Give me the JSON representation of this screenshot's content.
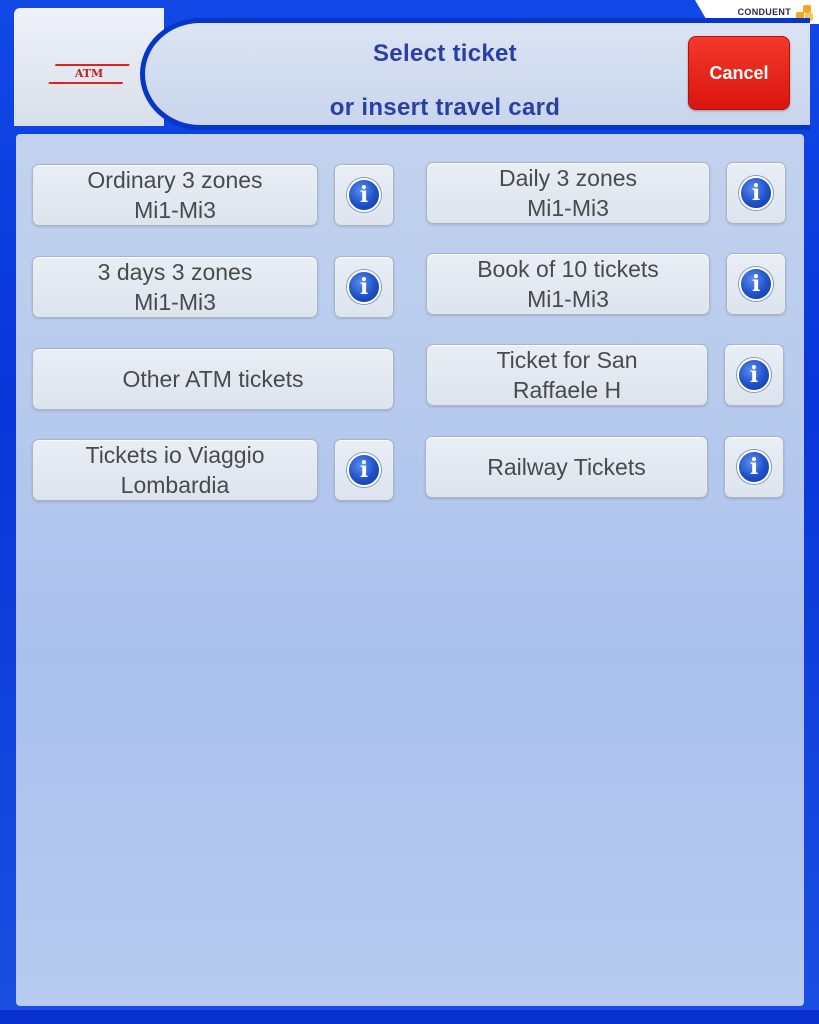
{
  "brand": {
    "vendor": "CONDUENT",
    "operator_logo": "ATM"
  },
  "header": {
    "title_line1": "Select ticket",
    "title_line2": "or insert travel card",
    "cancel_label": "Cancel"
  },
  "colors": {
    "accent_blue": "#0636c8",
    "cancel_red": "#e3211a",
    "title_text": "#2a3fa6"
  },
  "tickets": [
    {
      "line1": "Ordinary 3 zones",
      "line2": "Mi1-Mi3",
      "info": true
    },
    {
      "line1": "Daily 3 zones",
      "line2": "Mi1-Mi3",
      "info": true
    },
    {
      "line1": "3 days 3 zones",
      "line2": "Mi1-Mi3",
      "info": true
    },
    {
      "line1": "Book of 10 tickets",
      "line2": "Mi1-Mi3",
      "info": true
    },
    {
      "line1": "Other ATM tickets",
      "line2": "",
      "info": false
    },
    {
      "line1": "Ticket for San",
      "line2": "Raffaele H",
      "info": true
    },
    {
      "line1": "Tickets io Viaggio",
      "line2": "Lombardia",
      "info": true
    },
    {
      "line1": "Railway Tickets",
      "line2": "",
      "info": true
    }
  ],
  "info_icon_glyph": "i"
}
